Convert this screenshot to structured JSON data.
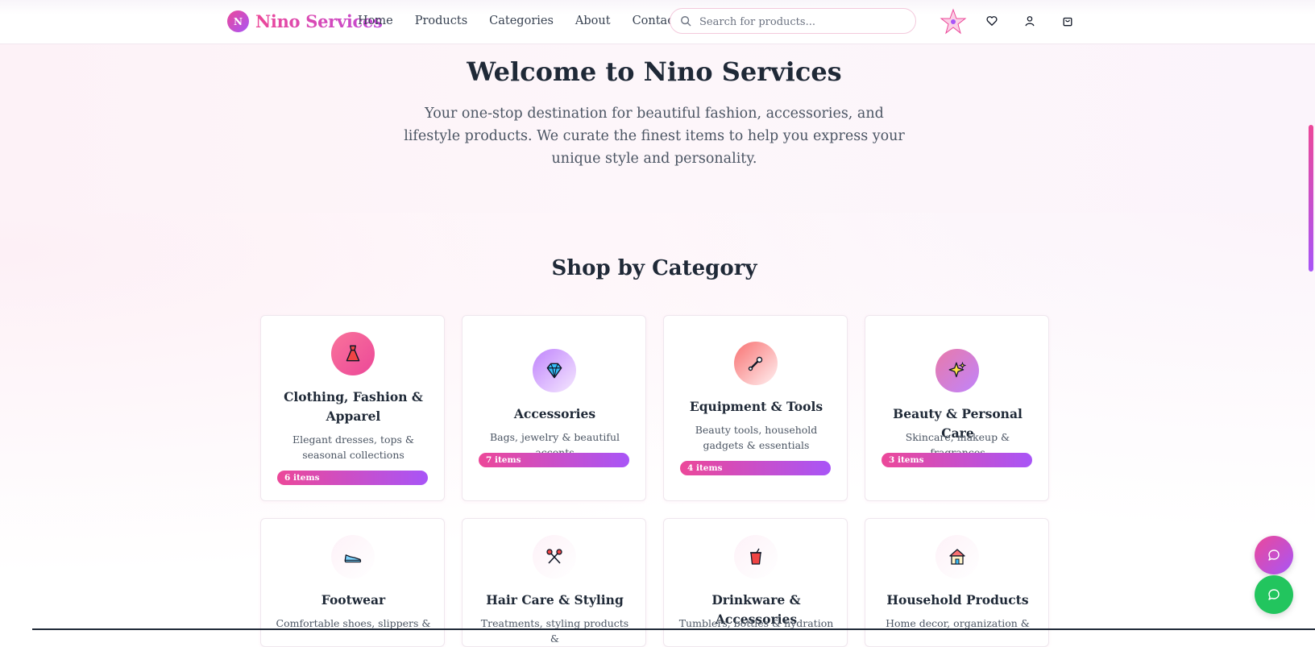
{
  "brand": {
    "badge": "N",
    "name": "Nino Services"
  },
  "nav": {
    "items": [
      "Home",
      "Products",
      "Categories",
      "About",
      "Contact"
    ]
  },
  "search": {
    "placeholder": "Search for products..."
  },
  "nav_icons": [
    "star-icon",
    "heart-icon",
    "user-icon",
    "shopping-bag-icon"
  ],
  "hero": {
    "title": "Welcome to Nino Services",
    "subtitle": "Your one-stop destination for beautiful fashion, accessories, and lifestyle products. We curate the finest items to help you express your unique style and personality."
  },
  "categories_section": {
    "title": "Shop by Category",
    "cards": [
      {
        "icon": "dress-icon",
        "title": "Clothing, Fashion & Apparel",
        "desc": "Elegant dresses, tops & seasonal collections",
        "count": "6 items"
      },
      {
        "icon": "gem-icon",
        "title": "Accessories",
        "desc": "Bags, jewelry & beautiful accents",
        "count": "7 items"
      },
      {
        "icon": "wrench-icon",
        "title": "Equipment & Tools",
        "desc": "Beauty tools, household gadgets & essentials",
        "count": "4 items"
      },
      {
        "icon": "sparkles-icon",
        "title": "Beauty & Personal Care",
        "desc": "Skincare, makeup & fragrances",
        "count": "3 items"
      },
      {
        "icon": "sneaker-icon",
        "title": "Footwear",
        "desc": "Comfortable shoes, slippers &"
      },
      {
        "icon": "scissors-icon",
        "title": "Hair Care & Styling",
        "desc": "Treatments, styling products &"
      },
      {
        "icon": "cup-icon",
        "title": "Drinkware & Accessories",
        "desc": "Tumblers, bottles & hydration"
      },
      {
        "icon": "house-icon",
        "title": "Household Products",
        "desc": "Home decor, organization &"
      }
    ]
  },
  "floating": [
    "chat-icon",
    "whatsapp-icon"
  ],
  "colors": {
    "accent_pink": "#ec4899",
    "accent_purple": "#a855f7",
    "whatsapp_green": "#22c55e"
  }
}
